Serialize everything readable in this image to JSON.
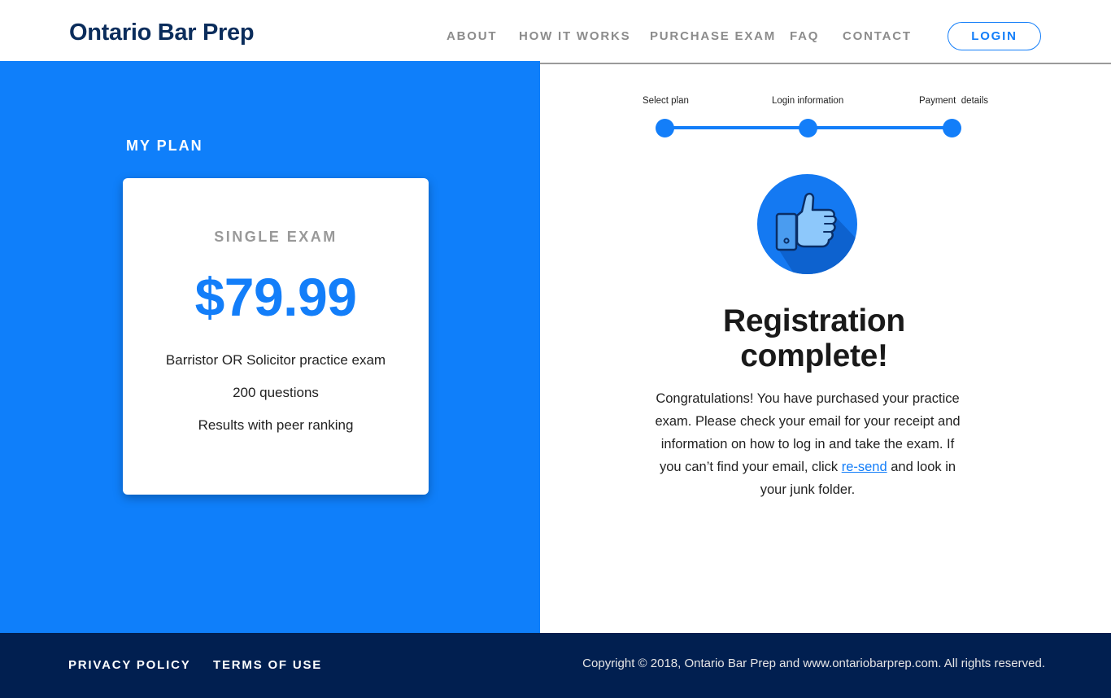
{
  "header": {
    "logo": "Ontario Bar Prep",
    "nav": [
      "ABOUT",
      "HOW IT WORKS",
      "PURCHASE EXAM",
      "FAQ",
      "CONTACT"
    ],
    "login_label": "LOGIN"
  },
  "plan": {
    "heading": "MY PLAN",
    "name": "SINGLE EXAM",
    "price": "$79.99",
    "features": [
      "Barristor OR Solicitor practice exam",
      "200 questions",
      "Results with peer ranking"
    ]
  },
  "stepper": {
    "steps": [
      "Select plan",
      "Login information",
      "Payment  details"
    ]
  },
  "confirmation": {
    "icon": "thumbs-up-icon",
    "title": "Registration complete!",
    "message_part1": "Congratulations! You have purchased your practice exam. Please check your email for your receipt and information on how to log in and take the exam. If you can’t find your email, click ",
    "resend_label": "re-send",
    "message_part2": " and look in your junk folder."
  },
  "footer": {
    "privacy_label": "PRIVACY POLICY",
    "terms_label": "TERMS OF USE",
    "copyright": "Copyright © 2018, Ontario Bar Prep and www.ontariobarprep.com. All rights reserved."
  },
  "colors": {
    "primary": "#137ef9",
    "panel": "#0f7ffa",
    "navy": "#011f50",
    "logo": "#0b2d5c"
  }
}
